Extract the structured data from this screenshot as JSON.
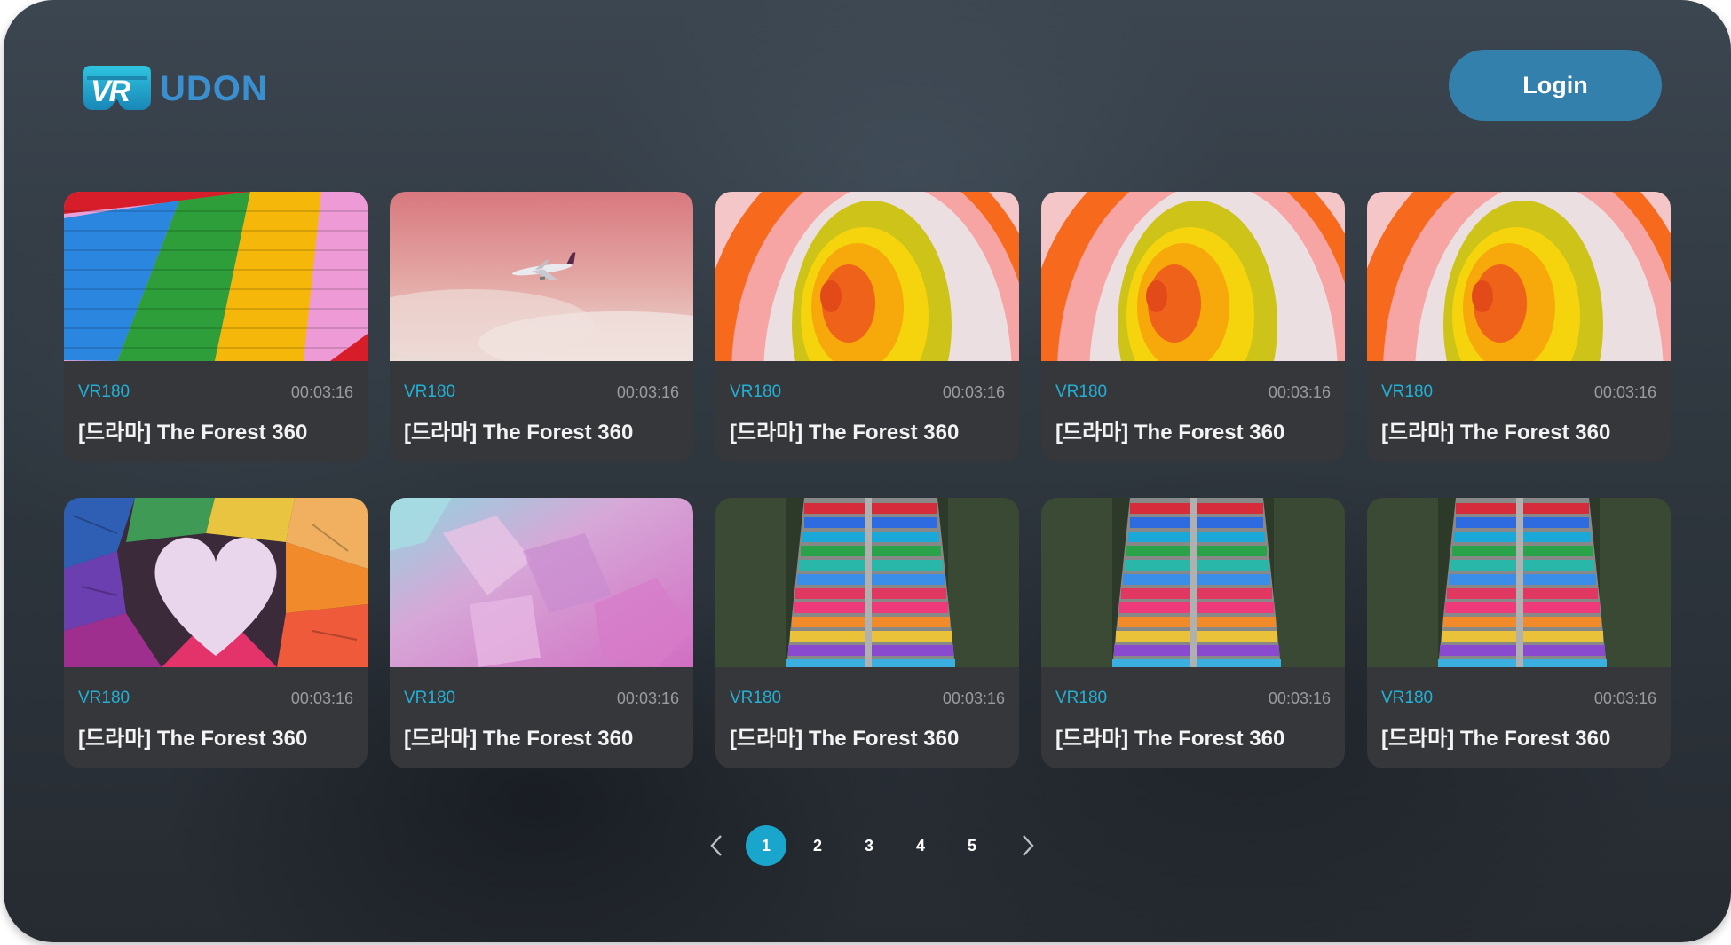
{
  "app": {
    "brand": "VR UDON",
    "logo_mark": "VR",
    "logo_word": "UDON"
  },
  "header": {
    "login_label": "Login"
  },
  "colors": {
    "accent": "#1aa6cc",
    "badge": "#23b0d6",
    "login_bg": "#3480ad",
    "card_bg": "#36373a"
  },
  "videos": [
    {
      "format": "VR180",
      "duration": "00:03:16",
      "title": "[드라마] The Forest 360",
      "thumbnail": "rainbow-brick-wall"
    },
    {
      "format": "VR180",
      "duration": "00:03:16",
      "title": "[드라마] The Forest 360",
      "thumbnail": "airplane-pink-sky"
    },
    {
      "format": "VR180",
      "duration": "00:03:16",
      "title": "[드라마] The Forest 360",
      "thumbnail": "colorful-arches"
    },
    {
      "format": "VR180",
      "duration": "00:03:16",
      "title": "[드라마] The Forest 360",
      "thumbnail": "colorful-arches"
    },
    {
      "format": "VR180",
      "duration": "00:03:16",
      "title": "[드라마] The Forest 360",
      "thumbnail": "colorful-arches"
    },
    {
      "format": "VR180",
      "duration": "00:03:16",
      "title": "[드라마] The Forest 360",
      "thumbnail": "thread-heart"
    },
    {
      "format": "VR180",
      "duration": "00:03:16",
      "title": "[드라마] The Forest 360",
      "thumbnail": "pink-crystals"
    },
    {
      "format": "VR180",
      "duration": "00:03:16",
      "title": "[드라마] The Forest 360",
      "thumbnail": "rainbow-stairs"
    },
    {
      "format": "VR180",
      "duration": "00:03:16",
      "title": "[드라마] The Forest 360",
      "thumbnail": "rainbow-stairs"
    },
    {
      "format": "VR180",
      "duration": "00:03:16",
      "title": "[드라마] The Forest 360",
      "thumbnail": "rainbow-stairs"
    }
  ],
  "pagination": {
    "pages": [
      "1",
      "2",
      "3",
      "4",
      "5"
    ],
    "current": "1",
    "prev_icon": "chevron-left-icon",
    "next_icon": "chevron-right-icon"
  }
}
